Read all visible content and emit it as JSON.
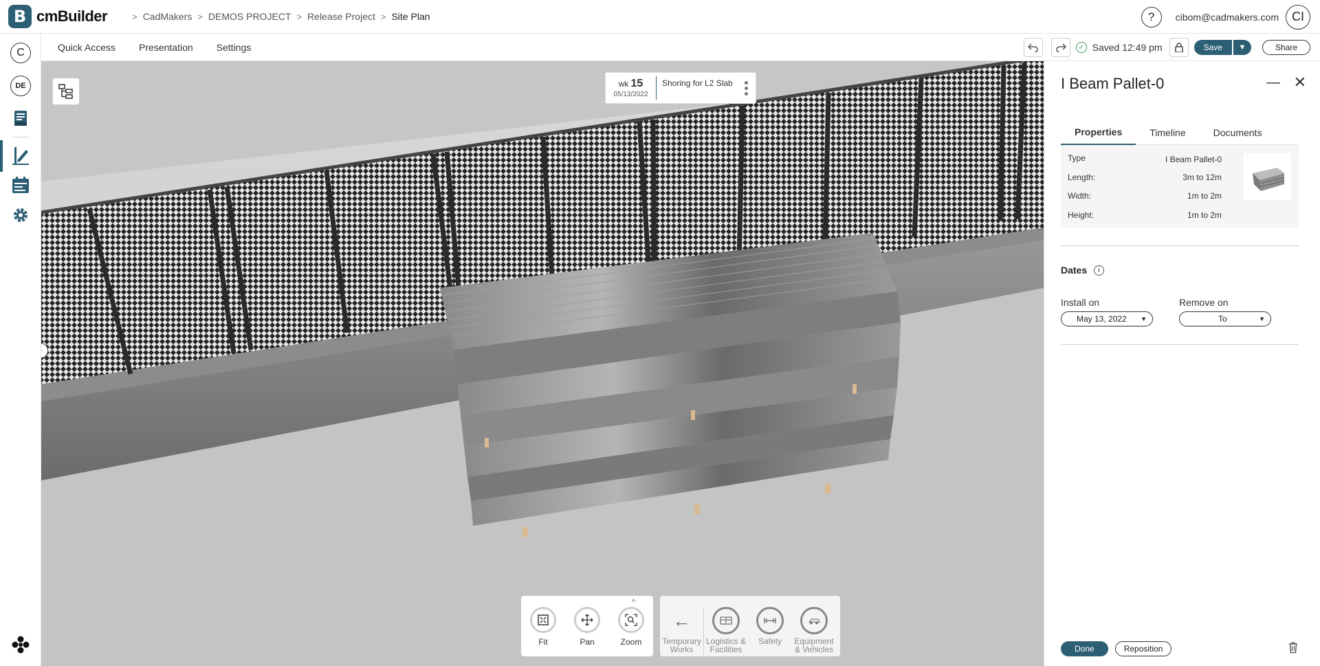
{
  "app": {
    "logo_letter": "B",
    "logo_text": "cmBuilder"
  },
  "breadcrumb": [
    "CadMakers",
    "DEMOS PROJECT",
    "Release Project",
    "Site Plan"
  ],
  "header": {
    "user_email": "cibom@cadmakers.com",
    "avatar_initials": "CI",
    "help_label": "?"
  },
  "sidebar": {
    "company_initial": "C",
    "user_initials": "DE"
  },
  "menu": {
    "items": [
      "Quick Access",
      "Presentation",
      "Settings"
    ],
    "saved_text": "Saved 12:49 pm",
    "save_label": "Save",
    "share_label": "Share"
  },
  "task": {
    "wk_label": "wk",
    "wk_number": "15",
    "date": "05/13/2022",
    "name": "Shoring for L2 Slab"
  },
  "nav_tools": [
    {
      "label": "Fit",
      "icon": "fit-icon"
    },
    {
      "label": "Pan",
      "icon": "pan-icon"
    },
    {
      "label": "Zoom",
      "icon": "zoom-icon"
    }
  ],
  "categories": {
    "back_label_1": "Temporary",
    "back_label_2": "Works",
    "items": [
      {
        "line1": "Logistics &",
        "line2": "Facilities",
        "icon": "logistics-icon"
      },
      {
        "line1": "Safety",
        "line2": "",
        "icon": "safety-icon"
      },
      {
        "line1": "Equipment",
        "line2": "& Vehicles",
        "icon": "vehicle-icon"
      }
    ]
  },
  "panel": {
    "title": "I Beam Pallet-0",
    "tabs": [
      "Properties",
      "Timeline",
      "Documents"
    ],
    "properties": [
      {
        "label": "Type",
        "value": "I Beam Pallet-0"
      },
      {
        "label": "Length:",
        "value": "3m to 12m"
      },
      {
        "label": "Width:",
        "value": "1m to 2m"
      },
      {
        "label": "Height:",
        "value": "1m to 2m"
      }
    ],
    "dates_heading": "Dates",
    "install_label": "Install on",
    "install_value": "May 13, 2022",
    "remove_label": "Remove on",
    "remove_value": "To",
    "done_label": "Done",
    "reposition_label": "Reposition"
  },
  "colors": {
    "brand": "#2d5f74",
    "saved_ok": "#3a9a58"
  }
}
